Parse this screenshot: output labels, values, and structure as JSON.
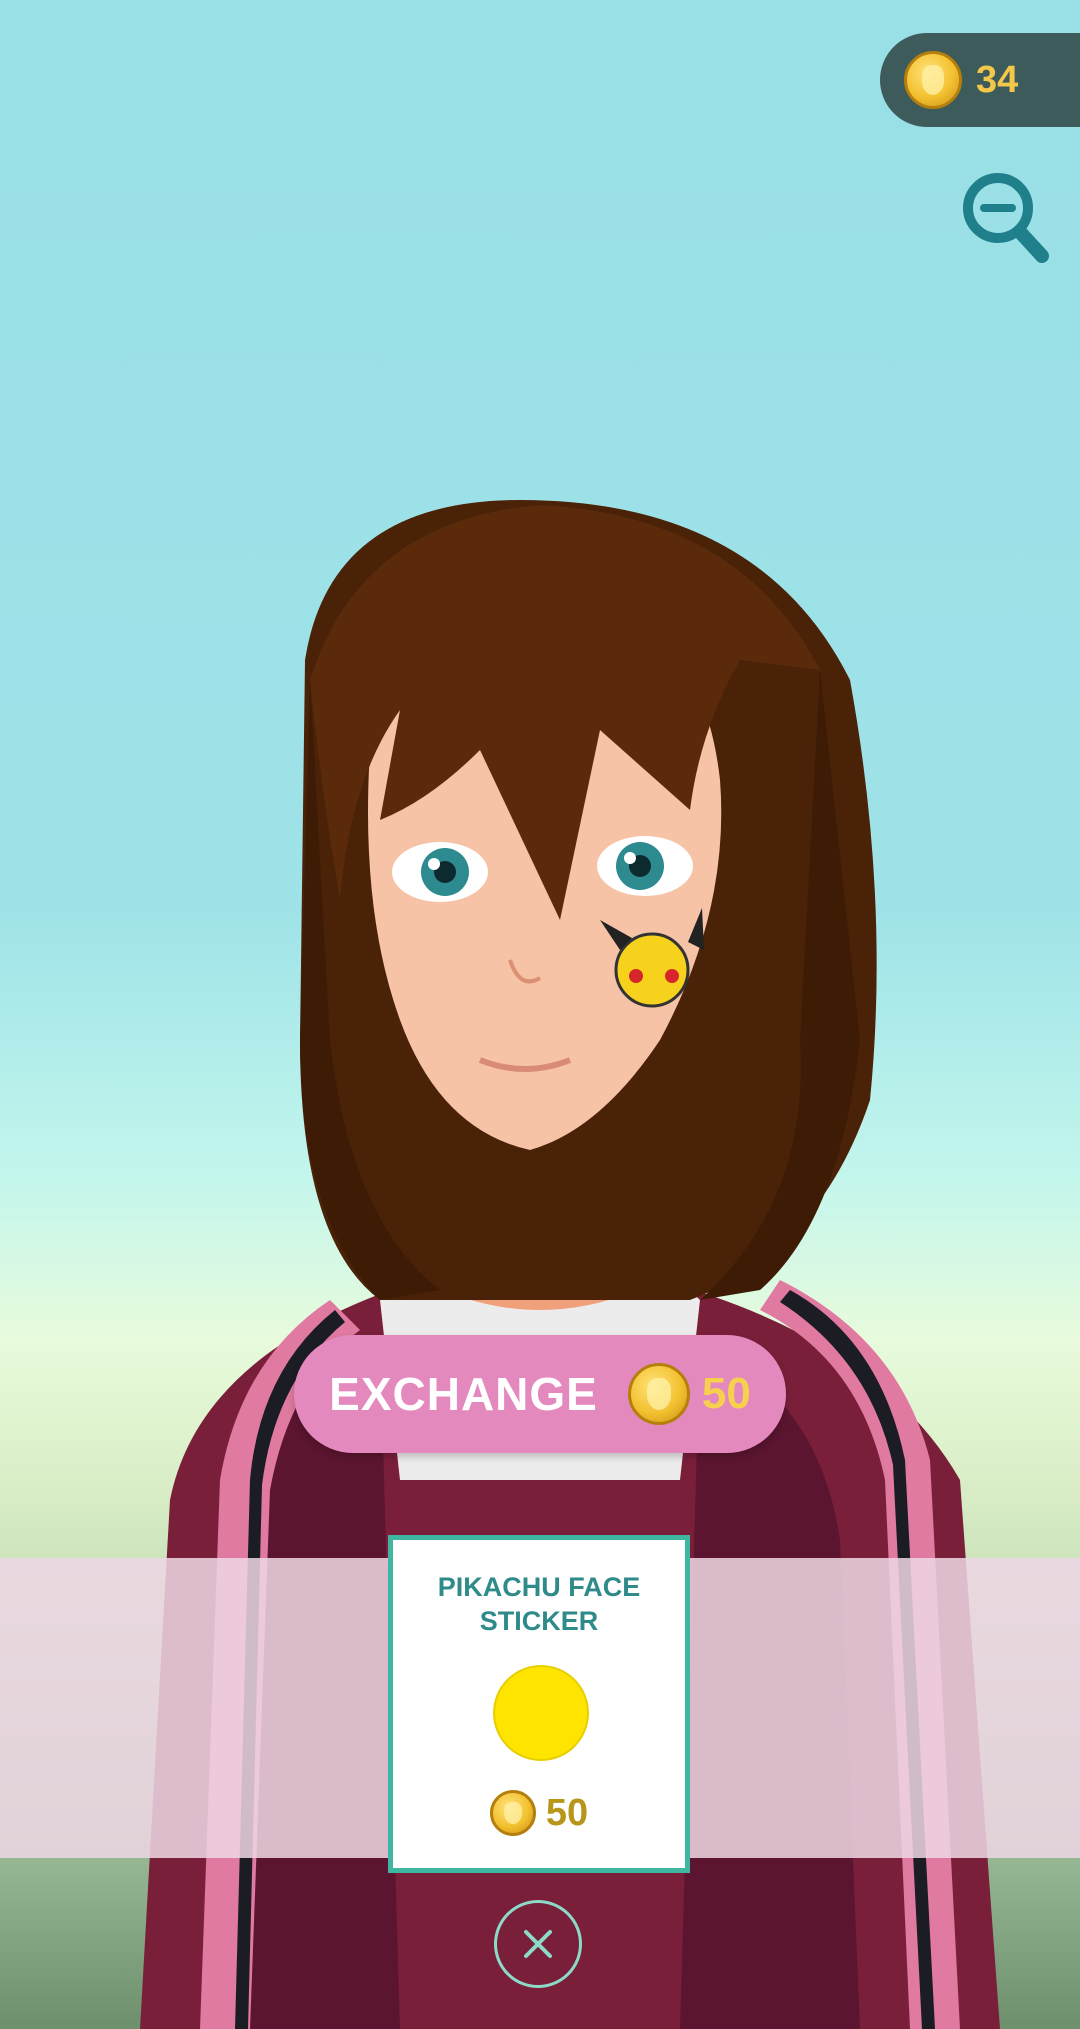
{
  "hud": {
    "coin_balance": "34",
    "coin_icon": "pokecoin-icon",
    "zoom_icon": "zoom-out-icon"
  },
  "exchange_button": {
    "label": "EXCHANGE",
    "price": "50"
  },
  "item": {
    "name": "PIKACHU FACE STICKER",
    "swatch_color": "#ffe400",
    "price": "50"
  },
  "close_icon": "close-icon",
  "colors": {
    "exchange_bg": "#e489bd",
    "card_border": "#3fb6a1",
    "coin_text": "#f4c74a"
  }
}
